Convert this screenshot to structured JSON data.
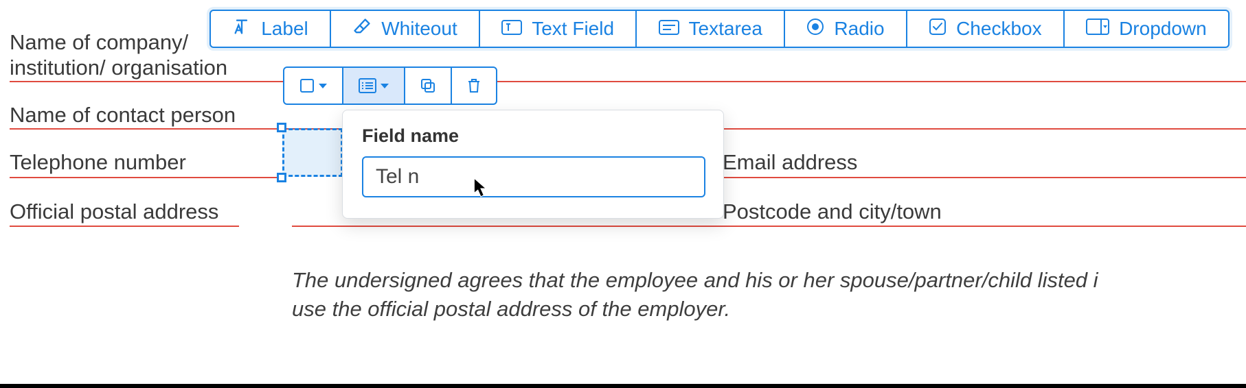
{
  "ribbon": {
    "label": "Label",
    "whiteout": "Whiteout",
    "textfield": "Text Field",
    "textarea": "Textarea",
    "radio": "Radio",
    "checkbox": "Checkbox",
    "dropdown": "Dropdown"
  },
  "form": {
    "company_line1": "Name of company/",
    "company_line2": "institution/ organisation",
    "contact": "Name of contact person",
    "telephone": "Telephone number",
    "postal": "Official postal address",
    "email": "Email address",
    "postcode": "Postcode and city/town"
  },
  "popover": {
    "title": "Field name",
    "value": "Tel n"
  },
  "agreement": {
    "line1": "The undersigned agrees that the employee and his or her spouse/partner/child listed i",
    "line2": "use the official postal address of the employer."
  },
  "colors": {
    "accent": "#1a82e2",
    "rule": "#e04a3f"
  }
}
